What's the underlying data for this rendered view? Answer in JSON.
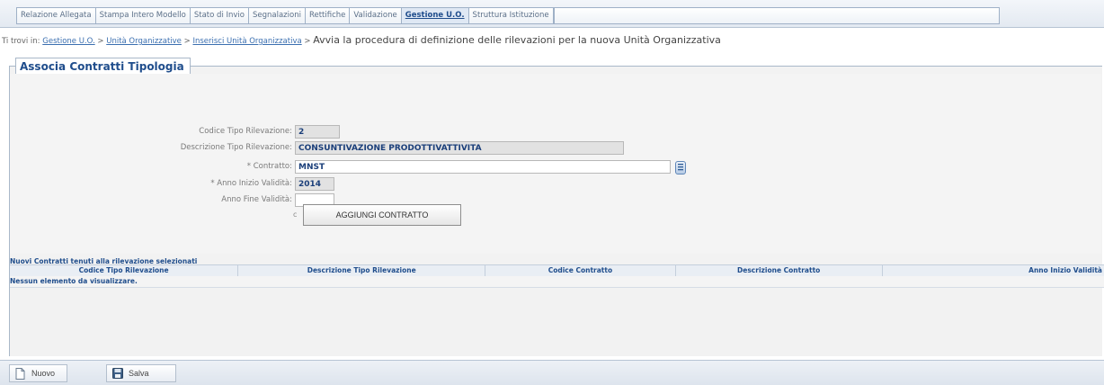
{
  "tabs": [
    {
      "label": "Relazione Allegata",
      "active": false
    },
    {
      "label": "Stampa Intero Modello",
      "active": false
    },
    {
      "label": "Stato di Invio",
      "active": false
    },
    {
      "label": "Segnalazioni",
      "active": false
    },
    {
      "label": "Rettifiche",
      "active": false
    },
    {
      "label": "Validazione",
      "active": false
    },
    {
      "label": "Gestione U.O.",
      "active": true
    },
    {
      "label": "Struttura Istituzione",
      "active": false
    }
  ],
  "breadcrumb": {
    "prefix": "Ti trovi in:",
    "items": [
      "Gestione U.O.",
      "Unità Organizzative",
      "Inserisci Unità Organizzativa"
    ],
    "separator": ">",
    "current": "Avvia la procedura di definizione delle rilevazioni per la nuova Unità Organizzativa"
  },
  "panel": {
    "legend": "Associa Contratti Tipologia"
  },
  "form": {
    "codice_tipo": {
      "label": "Codice Tipo Rilevazione:",
      "value": "2"
    },
    "descrizione_tipo": {
      "label": "Descrizione Tipo Rilevazione:",
      "value": "CONSUNTIVAZIONE PRODOTTIVATTIVITA"
    },
    "contratto": {
      "label": "* Contratto:",
      "value": "MNST"
    },
    "anno_inizio": {
      "label": "* Anno Inizio Validità:",
      "value": "2014"
    },
    "anno_fine": {
      "label": "Anno Fine Validità:",
      "value": ""
    },
    "add_button": {
      "prefix": "c",
      "label": "AGGIUNGI CONTRATTO"
    }
  },
  "table": {
    "title": "Nuovi Contratti tenuti alla rilevazione selezionati",
    "columns": [
      "Codice Tipo Rilevazione",
      "Descrizione Tipo Rilevazione",
      "Codice Contratto",
      "Descrizione Contratto",
      "Anno Inizio Validità"
    ],
    "empty_message": "Nessun elemento da visualizzare."
  },
  "toolbar": {
    "new_label": "Nuovo",
    "save_label": "Salva"
  },
  "colors": {
    "accent": "#1f4d8c",
    "link": "#3b6fb0",
    "panel_bg": "#f2f2f2"
  },
  "icons": {
    "lookup": "list-lookup-icon",
    "new": "new-document-icon",
    "save": "floppy-disk-icon"
  }
}
